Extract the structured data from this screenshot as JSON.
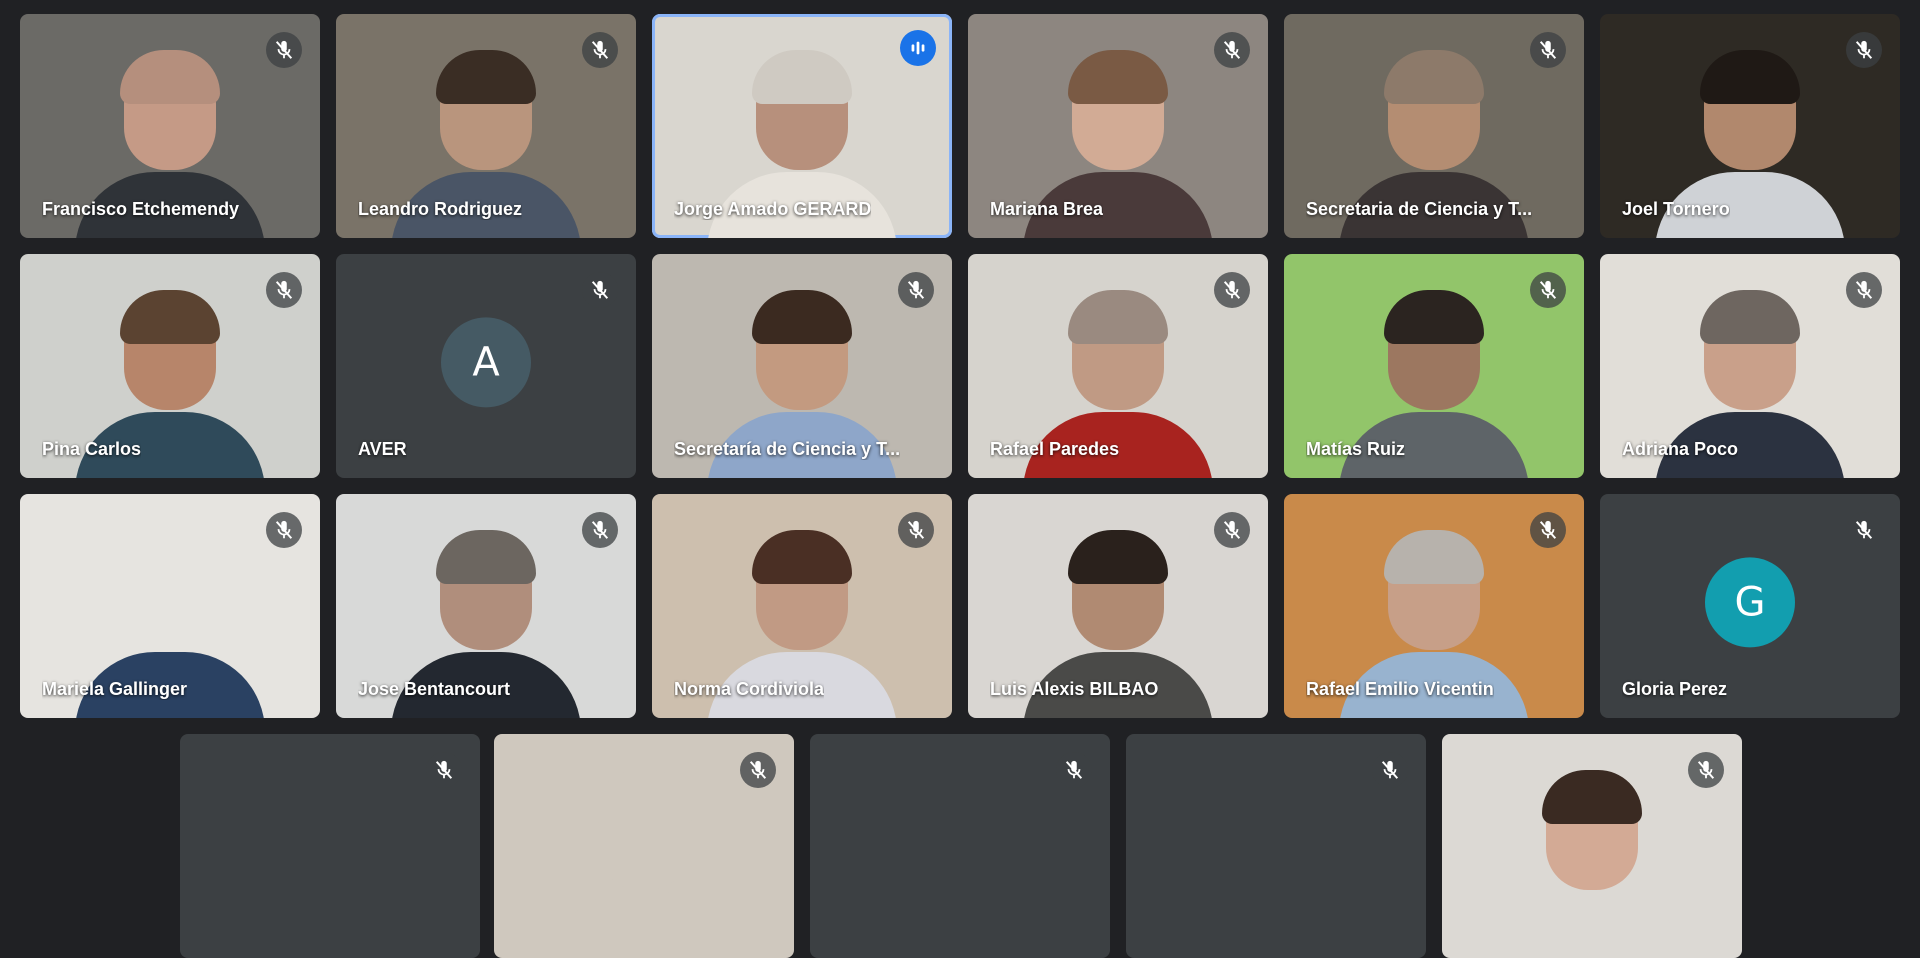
{
  "meeting": {
    "participants": [
      {
        "name": "Francisco Etchemendy",
        "muted": true,
        "speaking": false,
        "bg": "#6b6a66",
        "skin": "#c59a86",
        "hair": "#b58f7d",
        "shirt": "#2f3338"
      },
      {
        "name": "Leandro Rodriguez",
        "muted": true,
        "speaking": false,
        "bg": "#7a7368",
        "skin": "#b9957d",
        "hair": "#3a2d24",
        "shirt": "#4a5566"
      },
      {
        "name": "Jorge Amado GERARD",
        "muted": false,
        "speaking": true,
        "bg": "#d9d6cf",
        "skin": "#b7907c",
        "hair": "#cfcac2",
        "shirt": "#e7e3dc"
      },
      {
        "name": "Mariana Brea",
        "muted": true,
        "speaking": false,
        "bg": "#8d8680",
        "skin": "#d2ab95",
        "hair": "#7a5a44",
        "shirt": "#4a3a3a"
      },
      {
        "name": "Secretaria de Ciencia y T...",
        "muted": true,
        "speaking": false,
        "bg": "#6f6a60",
        "skin": "#b48d72",
        "hair": "#8d7a6a",
        "shirt": "#3a3434"
      },
      {
        "name": "Joel Tornero",
        "muted": true,
        "speaking": false,
        "bg": "#2e2a24",
        "skin": "#b1886d",
        "hair": "#1f1915",
        "shirt": "#cfd2d6"
      },
      {
        "name": "Pina Carlos",
        "muted": true,
        "speaking": false,
        "bg": "#cfd0cc",
        "skin": "#b7856a",
        "hair": "#5b4331",
        "shirt": "#2f4a5a"
      },
      {
        "name": "AVER",
        "muted": true,
        "speaking": false,
        "bg": "#3c4043",
        "avatar": "A",
        "avatar_color": "#455a64"
      },
      {
        "name": "Secretaría de Ciencia y T...",
        "muted": true,
        "speaking": false,
        "bg": "#bdb8b0",
        "skin": "#c39a80",
        "hair": "#3b2a20",
        "shirt": "#8ea6c9"
      },
      {
        "name": "Rafael Paredes",
        "muted": true,
        "speaking": false,
        "bg": "#d6d3cd",
        "skin": "#c09a84",
        "hair": "#9a8a80",
        "shirt": "#a8231f"
      },
      {
        "name": "Matías Ruiz",
        "muted": true,
        "speaking": false,
        "bg": "#92c56a",
        "skin": "#9c7760",
        "hair": "#2b2420",
        "shirt": "#5e6468"
      },
      {
        "name": "Adriana Poco",
        "muted": true,
        "speaking": false,
        "bg": "#e1ded8",
        "skin": "#c9a08a",
        "hair": "#6e6660",
        "shirt": "#2b3240"
      },
      {
        "name": "Mariela Gallinger",
        "muted": true,
        "speaking": false,
        "bg": "#e6e4e0",
        "skin": "#e6e4e0",
        "hair": "#e6e4e0",
        "shirt": "#2a4162"
      },
      {
        "name": "Jose Bentancourt",
        "muted": true,
        "speaking": false,
        "bg": "#d8d9d8",
        "skin": "#b08e7c",
        "hair": "#6c6660",
        "shirt": "#232830"
      },
      {
        "name": "Norma Cordiviola",
        "muted": true,
        "speaking": false,
        "bg": "#cdbfae",
        "skin": "#c19a84",
        "hair": "#4a2f24",
        "shirt": "#d9d9df"
      },
      {
        "name": "Luis Alexis BILBAO",
        "muted": true,
        "speaking": false,
        "bg": "#d9d6d2",
        "skin": "#b08a72",
        "hair": "#2a211c",
        "shirt": "#4a4a48"
      },
      {
        "name": "Rafael Emilio Vicentin",
        "muted": true,
        "speaking": false,
        "bg": "#c98a4a",
        "skin": "#c79f88",
        "hair": "#b7b2ac",
        "shirt": "#98b3cf"
      },
      {
        "name": "Gloria Perez",
        "muted": true,
        "speaking": false,
        "bg": "#3c4043",
        "avatar": "G",
        "avatar_color": "#129eaf"
      },
      {
        "name": "",
        "muted": true,
        "speaking": false,
        "bg": "#3c4043"
      },
      {
        "name": "",
        "muted": true,
        "speaking": false,
        "bg": "#cfc8be",
        "skin": "#cfc8be",
        "hair": "#cfc8be",
        "shirt": "#cfc8be"
      },
      {
        "name": "",
        "muted": true,
        "speaking": false,
        "bg": "#3c4043"
      },
      {
        "name": "",
        "muted": true,
        "speaking": false,
        "bg": "#3c4043"
      },
      {
        "name": "",
        "muted": true,
        "speaking": false,
        "bg": "#dcd9d4",
        "skin": "#d3aa95",
        "hair": "#3a2a22",
        "shirt": "#dcd9d4"
      }
    ]
  }
}
